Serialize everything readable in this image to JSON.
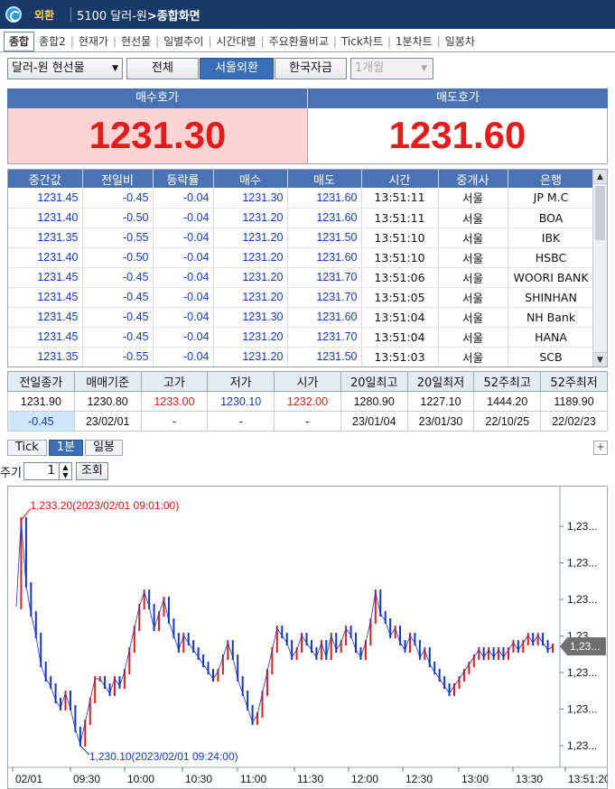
{
  "title": {
    "tag": "외환",
    "screen_prefix": "5100 달러-원",
    "screen_arrow": ">",
    "screen_name": "종합화면"
  },
  "tabs": [
    "종합",
    "종합2",
    "현재가",
    "현선물",
    "일별추이",
    "시간대별",
    "주요환율비교",
    "Tick차트",
    "1분차트",
    "일봉차"
  ],
  "controls": {
    "market": "달러-원 현선물",
    "btn_all": "전체",
    "btn_seoul": "서울외환",
    "btn_korea": "한국자금",
    "period": "1개월"
  },
  "quote": {
    "bid_label": "매수호가",
    "ask_label": "매도호가",
    "bid": "1231.30",
    "ask": "1231.60"
  },
  "trades": {
    "headers": [
      "중간값",
      "전일비",
      "등락률",
      "매수",
      "매도",
      "시간",
      "중개사",
      "은행"
    ],
    "rows": [
      [
        "1231.45",
        "-0.45",
        "-0.04",
        "1231.30",
        "1231.60",
        "13:51:11",
        "서울",
        "JP M.C"
      ],
      [
        "1231.40",
        "-0.50",
        "-0.04",
        "1231.20",
        "1231.60",
        "13:51:11",
        "서울",
        "BOA"
      ],
      [
        "1231.35",
        "-0.55",
        "-0.04",
        "1231.20",
        "1231.50",
        "13:51:10",
        "서울",
        "IBK"
      ],
      [
        "1231.40",
        "-0.50",
        "-0.04",
        "1231.20",
        "1231.60",
        "13:51:10",
        "서울",
        "HSBC"
      ],
      [
        "1231.45",
        "-0.45",
        "-0.04",
        "1231.20",
        "1231.70",
        "13:51:06",
        "서울",
        "WOORI BANK"
      ],
      [
        "1231.45",
        "-0.45",
        "-0.04",
        "1231.20",
        "1231.70",
        "13:51:05",
        "서울",
        "SHINHAN"
      ],
      [
        "1231.45",
        "-0.45",
        "-0.04",
        "1231.30",
        "1231.60",
        "13:51:04",
        "서울",
        "NH Bank"
      ],
      [
        "1231.45",
        "-0.45",
        "-0.04",
        "1231.20",
        "1231.70",
        "13:51:04",
        "서울",
        "HANA"
      ],
      [
        "1231.35",
        "-0.55",
        "-0.04",
        "1231.20",
        "1231.50",
        "13:51:03",
        "서울",
        "SCB"
      ]
    ]
  },
  "stats": {
    "headers": [
      "전일종가",
      "매매기준",
      "고가",
      "저가",
      "시가",
      "20일최고",
      "20일최저",
      "52주최고",
      "52주최저"
    ],
    "row1": [
      "1231.90",
      "1230.80",
      "1233.00",
      "1230.10",
      "1232.00",
      "1280.90",
      "1227.10",
      "1444.20",
      "1189.90"
    ],
    "row2": [
      "-0.45",
      "23/02/01",
      "-",
      "-",
      "-",
      "23/01/04",
      "23/01/30",
      "22/10/25",
      "22/02/23"
    ]
  },
  "chart_tabs": [
    "Tick",
    "1분",
    "일봉"
  ],
  "period": {
    "label": "주기",
    "value": "1",
    "button": "조회"
  },
  "chart_data": {
    "type": "line",
    "title": "",
    "xlabel": "",
    "ylabel": "",
    "x_ticks": [
      "02/01",
      "09:30",
      "10:00",
      "10:30",
      "11:00",
      "11:30",
      "12:00",
      "12:30",
      "13:00",
      "13:30",
      "13:51:20"
    ],
    "y_ticks": [
      "1,23...",
      "1,23...",
      "1,23...",
      "1,23...",
      "1,23...",
      "1,23...",
      "1,23..."
    ],
    "ylim": [
      1230.0,
      1233.3
    ],
    "high_annotation": "1,233.20(2023/02/01 09:01:00)",
    "low_annotation": "1,230.10(2023/02/01 09:24:00)",
    "current_label": "1,23...",
    "series": [
      {
        "values": [
          1232.0,
          1233.2,
          1232.3,
          1231.9,
          1231.6,
          1231.2,
          1231.0,
          1230.9,
          1230.7,
          1230.6,
          1230.8,
          1230.6,
          1230.3,
          1230.1,
          1230.4,
          1230.7,
          1231.0,
          1231.0,
          1230.9,
          1230.8,
          1231.0,
          1230.9,
          1231.1,
          1231.4,
          1231.7,
          1232.0,
          1232.2,
          1232.0,
          1231.7,
          1231.9,
          1232.1,
          1231.8,
          1231.6,
          1231.4,
          1231.6,
          1231.5,
          1231.4,
          1231.3,
          1231.2,
          1231.1,
          1231.0,
          1231.1,
          1231.3,
          1231.5,
          1231.3,
          1231.0,
          1230.8,
          1230.6,
          1230.4,
          1230.5,
          1230.8,
          1231.1,
          1231.4,
          1231.7,
          1231.6,
          1231.5,
          1231.3,
          1231.4,
          1231.6,
          1231.5,
          1231.4,
          1231.3,
          1231.5,
          1231.3,
          1231.6,
          1231.4,
          1231.5,
          1231.7,
          1231.6,
          1231.4,
          1231.3,
          1231.5,
          1231.8,
          1232.2,
          1231.9,
          1231.8,
          1231.6,
          1231.7,
          1231.5,
          1231.4,
          1231.6,
          1231.5,
          1231.3,
          1231.4,
          1231.2,
          1231.1,
          1231.0,
          1230.9,
          1230.8,
          1230.9,
          1231.0,
          1231.1,
          1231.2,
          1231.3,
          1231.4,
          1231.3,
          1231.4,
          1231.3,
          1231.4,
          1231.3,
          1231.4,
          1231.5,
          1231.4,
          1231.5,
          1231.6,
          1231.5,
          1231.6,
          1231.5,
          1231.4,
          1231.45
        ]
      }
    ]
  }
}
